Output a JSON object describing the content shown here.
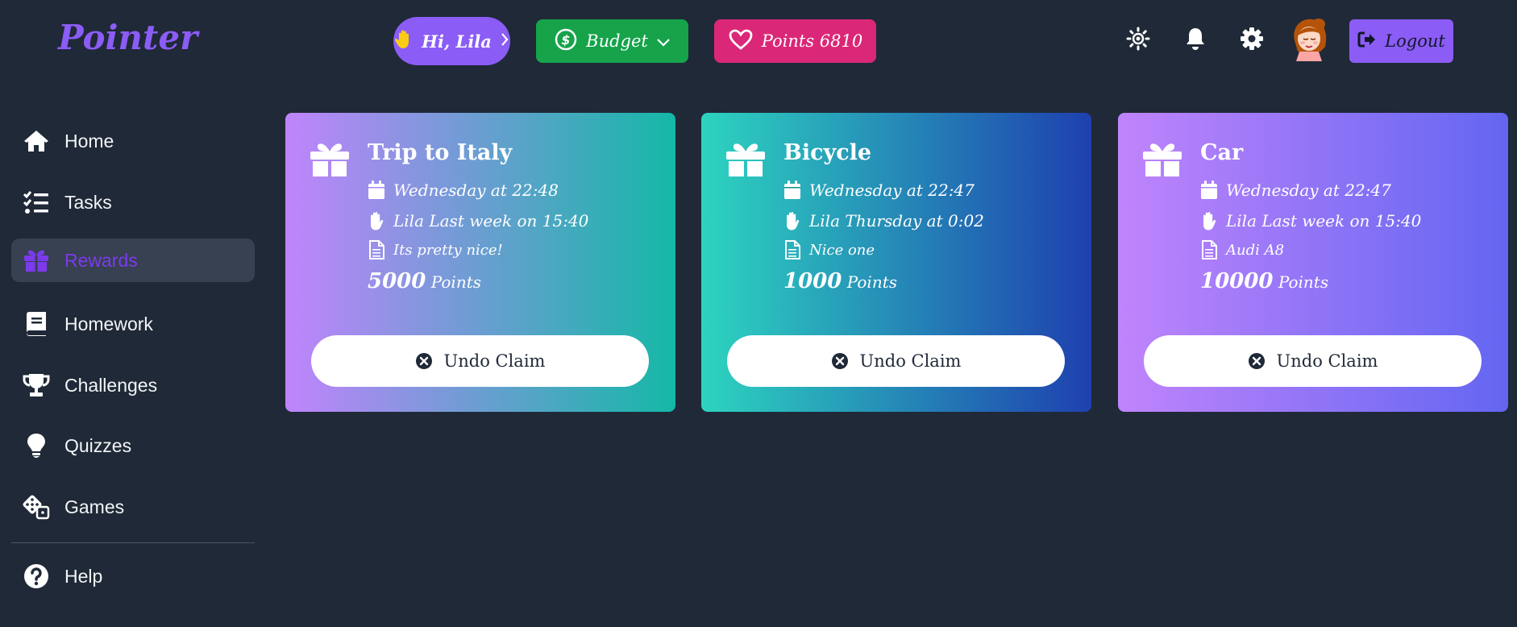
{
  "header": {
    "logo": "Pointer",
    "greeting": "Hi, Lila",
    "budget_label": "Budget",
    "points_label": "Points 6810",
    "logout_label": "Logout"
  },
  "sidebar": {
    "items": [
      {
        "label": "Home",
        "icon": "home-icon"
      },
      {
        "label": "Tasks",
        "icon": "tasks-icon"
      },
      {
        "label": "Rewards",
        "icon": "gift-icon",
        "active": true
      },
      {
        "label": "Homework",
        "icon": "book-icon"
      },
      {
        "label": "Challenges",
        "icon": "trophy-icon"
      },
      {
        "label": "Quizzes",
        "icon": "lightbulb-icon"
      },
      {
        "label": "Games",
        "icon": "dice-icon"
      }
    ],
    "help_label": "Help"
  },
  "rewards": [
    {
      "title": "Trip to Italy",
      "created": "Wednesday at 22:48",
      "claimed": "Lila  Last week on 15:40",
      "note": "Its pretty nice!",
      "points_value": "5000",
      "points_unit": "Points",
      "action": "Undo Claim",
      "gradient": [
        "#c084fc",
        "#14b8a6"
      ]
    },
    {
      "title": "Bicycle",
      "created": "Wednesday at 22:47",
      "claimed": "Lila  Thursday at 0:02",
      "note": "Nice one",
      "points_value": "1000",
      "points_unit": "Points",
      "action": "Undo Claim",
      "gradient": [
        "#2dd4bf",
        "#1e40af"
      ]
    },
    {
      "title": "Car",
      "created": "Wednesday at 22:47",
      "claimed": "Lila  Last week on 15:40",
      "note": "Audi A8",
      "points_value": "10000",
      "points_unit": "Points",
      "action": "Undo Claim",
      "gradient": [
        "#c084fc",
        "#6366f1"
      ]
    }
  ],
  "colors": {
    "background": "#1f2937",
    "accent": "#8b5cf6",
    "budget": "#16a34a",
    "points": "#db2777"
  }
}
